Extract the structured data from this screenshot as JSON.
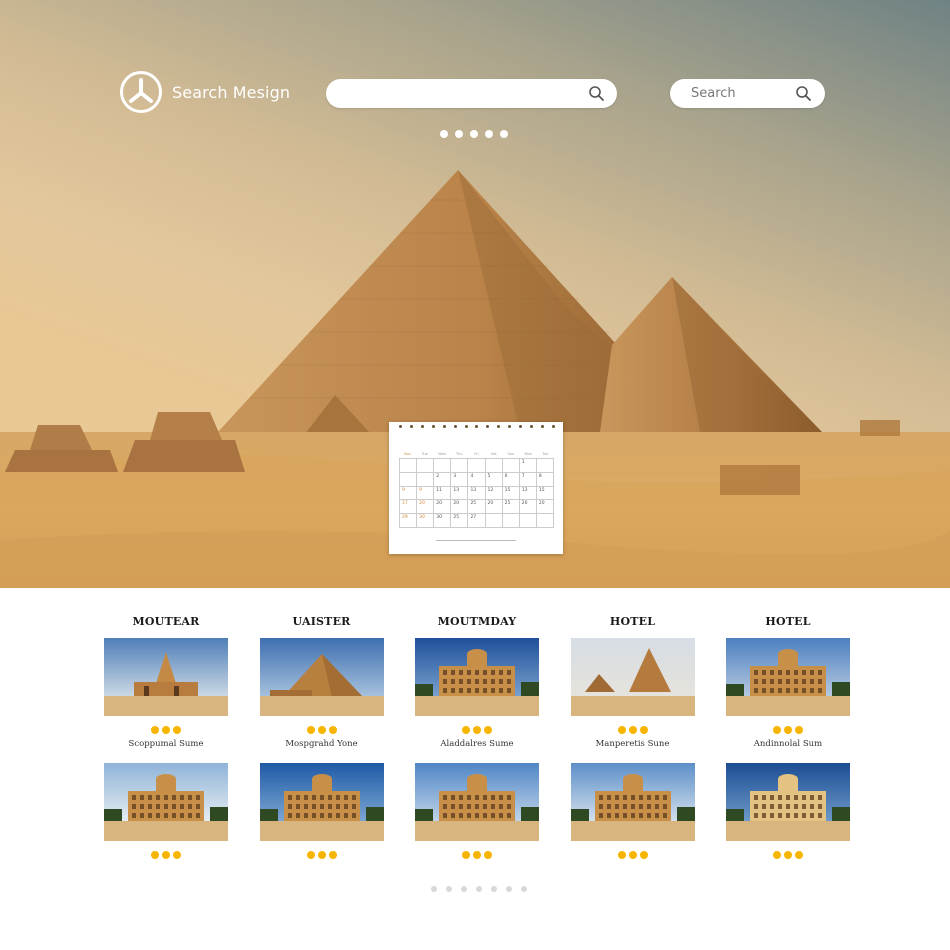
{
  "header": {
    "logo_text": "Search Mesign",
    "logo_icon": "tri-spoke-circle-icon",
    "main_search": {
      "value": "",
      "placeholder": "",
      "icon": "search-icon"
    },
    "secondary_search": {
      "value": "",
      "placeholder": "Search",
      "icon": "search-icon"
    },
    "carousel_dots": 5
  },
  "calendar": {
    "weekdays": [
      "Mon",
      "Tue",
      "Wed",
      "Thu",
      "Fri",
      "Sat",
      "Sun",
      "Mon",
      "Tue"
    ],
    "weeks": [
      [
        "",
        "",
        "",
        "",
        "",
        "",
        "",
        "1",
        ""
      ],
      [
        "",
        "",
        "2",
        "3",
        "4",
        "5",
        "6",
        "7",
        "8"
      ],
      [
        "9",
        "9",
        "11",
        "13",
        "13",
        "12",
        "15",
        "13",
        "15"
      ],
      [
        "17",
        "20",
        "20",
        "20",
        "25",
        "20",
        "25",
        "20",
        "20"
      ],
      [
        "29",
        "30",
        "30",
        "25",
        "27",
        "",
        "",
        "",
        ""
      ]
    ]
  },
  "gallery": {
    "row1": [
      {
        "title": "MOUTEAR",
        "subtitle": "Scoppumal Sume",
        "image": "nubian-pyramid-ruins",
        "rating": 3
      },
      {
        "title": "UAISTER",
        "subtitle": "Mospgrahd Yone",
        "image": "step-pyramid",
        "rating": 3
      },
      {
        "title": "MOUTMDAY",
        "subtitle": "Aladdalres Sume",
        "image": "hotel-building",
        "rating": 3
      },
      {
        "title": "HOTEL",
        "subtitle": "Manperetis Sune",
        "image": "twin-pyramids",
        "rating": 3
      },
      {
        "title": "HOTEL",
        "subtitle": "Andinnolal Sum",
        "image": "hotel-palm",
        "rating": 3
      }
    ],
    "row2": [
      {
        "image": "hotel-palms",
        "rating": 3
      },
      {
        "image": "hotel-domed",
        "rating": 3
      },
      {
        "image": "hotel-long",
        "rating": 3
      },
      {
        "image": "hotel-clouds",
        "rating": 3
      },
      {
        "image": "hotel-cream",
        "rating": 3
      }
    ],
    "pager_dots": 7
  },
  "colors": {
    "rating": "#f7b500",
    "sand": "#d9a85a",
    "sky_top": "#6f8284"
  }
}
